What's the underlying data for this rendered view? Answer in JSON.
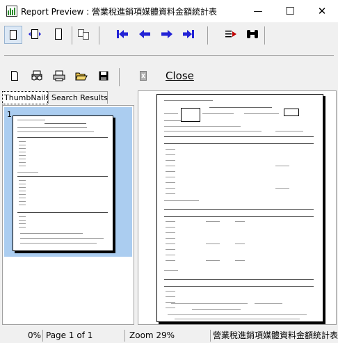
{
  "window": {
    "title": "Report Preview : 營業稅進銷項媒體資料金額統計表",
    "minimize_glyph": "—",
    "maximize_glyph": "☐",
    "close_glyph": "✕"
  },
  "toolbar": {
    "close_label": "Close",
    "icons": [
      "single-page-icon",
      "page-width-icon",
      "full-page-icon",
      "multi-page-icon",
      "first-page-icon",
      "previous-page-icon",
      "next-page-icon",
      "last-page-icon",
      "goto-page-icon",
      "find-icon",
      "new-page-icon",
      "print-setup-icon",
      "print-icon",
      "open-icon",
      "save-icon",
      "close-doc-icon"
    ]
  },
  "tabs": {
    "thumbnails": "ThumbNails",
    "search_results": "Search Results"
  },
  "thumbnail": {
    "page_number": "1"
  },
  "status": {
    "progress": "0%",
    "page": "Page 1 of 1",
    "zoom": "Zoom 29%",
    "report_name": "營業稅進銷項媒體資料金額統計表"
  },
  "colors": {
    "nav_arrow": "#2323d6",
    "thumb_selected": "#abcdf0"
  }
}
